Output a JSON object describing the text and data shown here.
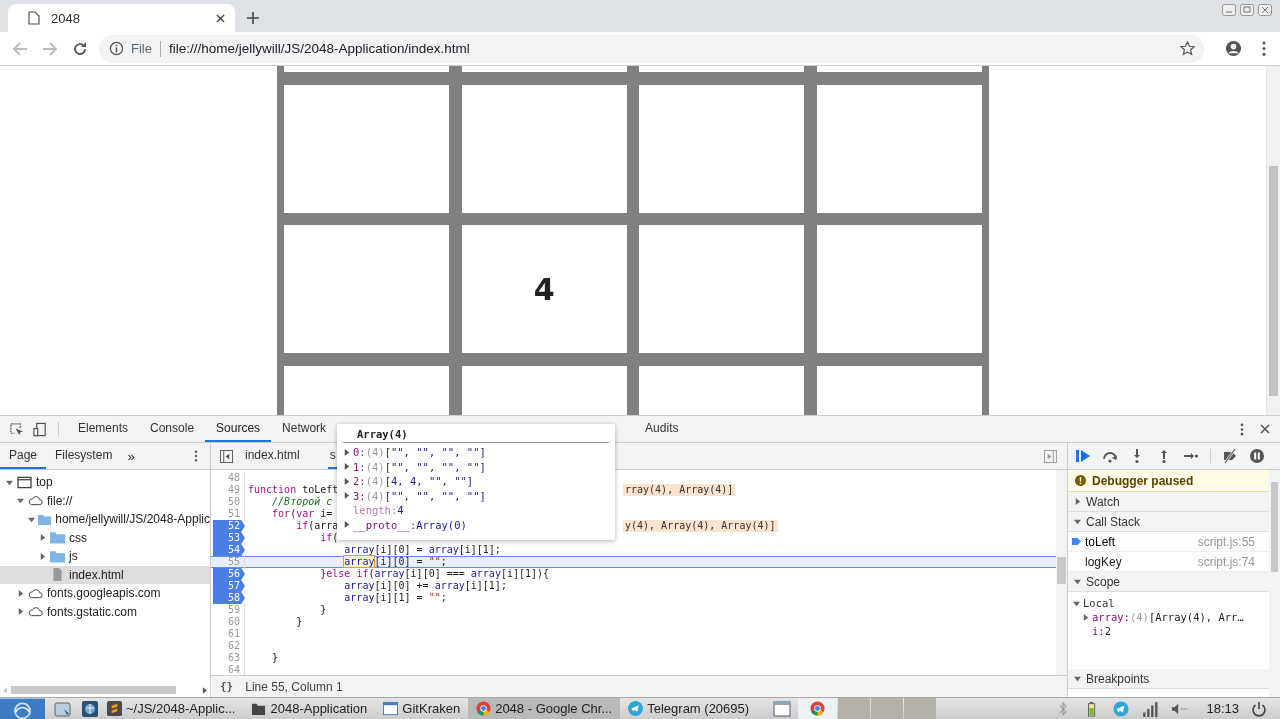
{
  "browser": {
    "tab": {
      "title": "2048"
    },
    "address": {
      "scheme_label": "File",
      "url": "file:///home/jellywill/JS/2048-Application/index.html"
    }
  },
  "board": {
    "rows": [
      [
        null,
        null,
        null,
        null
      ],
      [
        null,
        null,
        null,
        null
      ],
      [
        null,
        "4",
        null,
        null
      ],
      [
        null,
        null,
        null,
        null
      ]
    ]
  },
  "devtools": {
    "tabs": [
      {
        "label": "Elements",
        "selected": false
      },
      {
        "label": "Console",
        "selected": false
      },
      {
        "label": "Sources",
        "selected": true
      },
      {
        "label": "Network",
        "selected": false
      },
      {
        "label": "Audits",
        "selected": false
      }
    ],
    "navigator": {
      "tabs": [
        {
          "label": "Page",
          "selected": true
        },
        {
          "label": "Filesystem",
          "selected": false
        }
      ],
      "more": "»",
      "tree": [
        {
          "label": "top",
          "kind": "frame",
          "expanded": true,
          "selected": false,
          "children": [
            {
              "label": "file://",
              "kind": "origin",
              "expanded": true,
              "selected": false,
              "children": [
                {
                  "label": "home/jellywill/JS/2048-Applic",
                  "kind": "folder",
                  "expanded": true,
                  "selected": false,
                  "children": [
                    {
                      "label": "css",
                      "kind": "folder",
                      "expanded": false,
                      "selected": false
                    },
                    {
                      "label": "js",
                      "kind": "folder",
                      "expanded": false,
                      "selected": false
                    },
                    {
                      "label": "index.html",
                      "kind": "file",
                      "selected": true
                    }
                  ]
                }
              ]
            },
            {
              "label": "fonts.googleapis.com",
              "kind": "origin",
              "expanded": false,
              "selected": false
            },
            {
              "label": "fonts.gstatic.com",
              "kind": "origin",
              "expanded": false,
              "selected": false
            }
          ]
        }
      ]
    },
    "editor": {
      "tabs": [
        {
          "label": "index.html",
          "selected": false
        },
        {
          "label": "s",
          "selected": true
        }
      ],
      "lines": [
        {
          "number": "48",
          "breakpoint": false,
          "current": false
        },
        {
          "number": "49",
          "breakpoint": false,
          "current": false,
          "segments": [
            {
              "t": "function",
              "kind": "keyword"
            },
            {
              "t": " toLeft",
              "kind": "plain"
            }
          ],
          "inline_value": "rray(4), Array(4)]"
        },
        {
          "number": "50",
          "breakpoint": false,
          "current": false,
          "segments": [
            {
              "t": "    //Второй с",
              "kind": "comment"
            }
          ]
        },
        {
          "number": "51",
          "breakpoint": false,
          "current": false,
          "segments": [
            {
              "t": "    for",
              "kind": "keyword"
            },
            {
              "t": "(",
              "kind": "plain"
            },
            {
              "t": "var",
              "kind": "keyword"
            },
            {
              "t": " i=",
              "kind": "plain"
            }
          ]
        },
        {
          "number": "52",
          "breakpoint": true,
          "current": false,
          "segments": [
            {
              "t": "        if",
              "kind": "keyword"
            },
            {
              "t": "(arra",
              "kind": "plain"
            }
          ],
          "inline_value": "y(4), Array(4), Array(4)]"
        },
        {
          "number": "53",
          "breakpoint": true,
          "current": false,
          "segments": [
            {
              "t": "            if",
              "kind": "keyword"
            },
            {
              "t": "(",
              "kind": "plain"
            }
          ]
        },
        {
          "number": "54",
          "breakpoint": true,
          "current": false,
          "segments": [
            {
              "t": "                array",
              "kind": "identifier"
            },
            {
              "t": "[i][0] = ",
              "kind": "plain"
            },
            {
              "t": "array",
              "kind": "identifier"
            },
            {
              "t": "[i][1];",
              "kind": "plain"
            }
          ]
        },
        {
          "number": "55",
          "breakpoint": false,
          "current": true,
          "segments": [
            {
              "t": "                array",
              "kind": "identifier",
              "hovered": true
            },
            {
              "t": "[i][0] = ",
              "kind": "plain"
            },
            {
              "t": "\"\"",
              "kind": "string"
            },
            {
              "t": ";",
              "kind": "plain"
            }
          ]
        },
        {
          "number": "56",
          "breakpoint": true,
          "current": false,
          "segments": [
            {
              "t": "            }",
              "kind": "plain"
            },
            {
              "t": "else if",
              "kind": "keyword"
            },
            {
              "t": "(",
              "kind": "plain"
            },
            {
              "t": "array",
              "kind": "identifier"
            },
            {
              "t": "[i][0] === ",
              "kind": "plain"
            },
            {
              "t": "array",
              "kind": "identifier"
            },
            {
              "t": "[i][1]){",
              "kind": "plain"
            }
          ]
        },
        {
          "number": "57",
          "breakpoint": true,
          "current": false,
          "segments": [
            {
              "t": "                array",
              "kind": "identifier"
            },
            {
              "t": "[i][0] += ",
              "kind": "plain"
            },
            {
              "t": "array",
              "kind": "identifier"
            },
            {
              "t": "[i][1];",
              "kind": "plain"
            }
          ]
        },
        {
          "number": "58",
          "breakpoint": true,
          "current": false,
          "segments": [
            {
              "t": "                array",
              "kind": "identifier"
            },
            {
              "t": "[i][1] = ",
              "kind": "plain"
            },
            {
              "t": "\"\"",
              "kind": "string"
            },
            {
              "t": ";",
              "kind": "plain"
            }
          ]
        },
        {
          "number": "59",
          "breakpoint": false,
          "current": false,
          "segments": [
            {
              "t": "            }",
              "kind": "plain"
            }
          ]
        },
        {
          "number": "60",
          "breakpoint": false,
          "current": false,
          "segments": [
            {
              "t": "        }",
              "kind": "plain"
            }
          ]
        },
        {
          "number": "61",
          "breakpoint": false,
          "current": false
        },
        {
          "number": "62",
          "breakpoint": false,
          "current": false
        },
        {
          "number": "63",
          "breakpoint": false,
          "current": false,
          "segments": [
            {
              "t": "    }",
              "kind": "plain"
            }
          ]
        },
        {
          "number": "64",
          "breakpoint": false,
          "current": false
        }
      ],
      "format_label": "{}",
      "status": "Line 55, Column 1"
    },
    "popover": {
      "title": "Array(4)",
      "entries": [
        {
          "key": "0:",
          "count": "(4)",
          "value": "[\"\", \"\", \"\", \"\"]",
          "expanded": false
        },
        {
          "key": "1:",
          "count": "(4)",
          "value": "[\"\", \"\", \"\", \"\"]",
          "expanded": false
        },
        {
          "key": "2:",
          "count": "(4)",
          "value": "[4, 4, \"\", \"\"]",
          "expanded": false
        },
        {
          "key": "3:",
          "count": "(4)",
          "value": "[\"\", \"\", \"\", \"\"]",
          "expanded": false
        },
        {
          "key": "length:",
          "value": "4"
        },
        {
          "key": "__proto__:",
          "value": "Array(0)",
          "expanded": false
        }
      ]
    },
    "debugger": {
      "banner": "Debugger paused",
      "sections": [
        {
          "title": "Watch",
          "expanded": false
        },
        {
          "title": "Call Stack",
          "expanded": true,
          "frames": [
            {
              "name": "toLeft",
              "location": "script.js:55",
              "current": true
            },
            {
              "name": "logKey",
              "location": "script.js:74",
              "current": false
            }
          ]
        },
        {
          "title": "Scope",
          "expanded": true,
          "scopes": [
            {
              "title": "Local",
              "expanded": true,
              "vars": [
                {
                  "name": "array:",
                  "count": "(4)",
                  "value": "[Array(4), Arr…",
                  "expanded": false
                },
                {
                  "name": "i:",
                  "value": "2"
                }
              ]
            }
          ]
        },
        {
          "title": "Breakpoints",
          "expanded": true
        }
      ]
    }
  },
  "taskbar": {
    "tasks": [
      {
        "label": "~/JS/2048-Applic...",
        "kind": "editor",
        "active": false
      },
      {
        "label": "2048-Application",
        "kind": "folder",
        "active": false
      },
      {
        "label": "GitKraken",
        "kind": "window",
        "active": false
      },
      {
        "label": "2048 - Google Chr...",
        "kind": "browser",
        "active": true
      },
      {
        "label": "Telegram (20695)",
        "kind": "messenger",
        "active": false
      }
    ],
    "clock": "18:13"
  }
}
